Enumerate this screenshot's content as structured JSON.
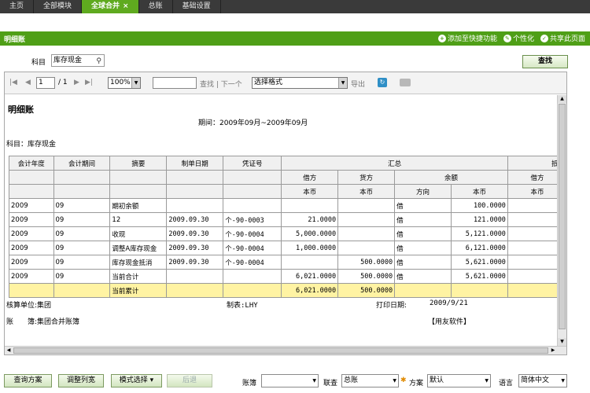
{
  "tabs": [
    {
      "label": "主页",
      "active": false
    },
    {
      "label": "全部模块",
      "active": false
    },
    {
      "label": "全球合并",
      "active": true,
      "close": "×"
    },
    {
      "label": "总账",
      "active": false
    },
    {
      "label": "基础设置",
      "active": false
    }
  ],
  "titlebar": {
    "title": "明细账",
    "add_shortcut": "添加至快捷功能",
    "personalize": "个性化",
    "share": "共享此页面"
  },
  "filter": {
    "subject_label": "科目",
    "subject_value": "库存现金",
    "search_button": "查找"
  },
  "viewer": {
    "page_current": "1",
    "page_total": "/ 1",
    "zoom": "100%",
    "find_label": "查找 | 下一个",
    "format_select": "选择格式",
    "export_label": "导出"
  },
  "report": {
    "title": "明细账",
    "period": "期间：2009年09月~2009年09月",
    "subject": "科目：库存现金",
    "header1": [
      "会计年度",
      "会计期间",
      "摘要",
      "制单日期",
      "凭证号",
      "汇总",
      "抵消"
    ],
    "header2": [
      "借方",
      "货方",
      "余额",
      "借方"
    ],
    "header3": [
      "本币",
      "本币",
      "方向",
      "本币",
      "本币"
    ],
    "rows": [
      {
        "year": "2009",
        "period": "09",
        "summary": "期初余额",
        "date": "",
        "voucher": "",
        "debit": "",
        "credit": "",
        "dir": "借",
        "balance": "100.0000",
        "offset_debit": ""
      },
      {
        "year": "2009",
        "period": "09",
        "summary": "12",
        "date": "2009.09.30",
        "voucher": "个-90-0003",
        "debit": "21.0000",
        "credit": "",
        "dir": "借",
        "balance": "121.0000",
        "offset_debit": ""
      },
      {
        "year": "2009",
        "period": "09",
        "summary": "收现",
        "date": "2009.09.30",
        "voucher": "个-90-0004",
        "debit": "5,000.0000",
        "credit": "",
        "dir": "借",
        "balance": "5,121.0000",
        "offset_debit": ""
      },
      {
        "year": "2009",
        "period": "09",
        "summary": "调整A库存现金",
        "date": "2009.09.30",
        "voucher": "个-90-0004",
        "debit": "1,000.0000",
        "credit": "",
        "dir": "借",
        "balance": "6,121.0000",
        "offset_debit": ""
      },
      {
        "year": "2009",
        "period": "09",
        "summary": "库存现金抵消",
        "date": "2009.09.30",
        "voucher": "个-90-0004",
        "debit": "",
        "credit": "500.0000",
        "dir": "借",
        "balance": "5,621.0000",
        "offset_debit": ""
      },
      {
        "year": "2009",
        "period": "09",
        "summary": "当前合计",
        "date": "",
        "voucher": "",
        "debit": "6,021.0000",
        "credit": "500.0000",
        "dir": "借",
        "balance": "5,621.0000",
        "offset_debit": ""
      },
      {
        "year": "",
        "period": "",
        "summary": "当前累计",
        "date": "",
        "voucher": "",
        "debit": "6,021.0000",
        "credit": "500.0000",
        "dir": "",
        "balance": "",
        "offset_debit": "",
        "highlight": true
      }
    ],
    "footer": {
      "unit": "核算单位:集团",
      "maker": "制表:LHY",
      "print_date_label": "打印日期:",
      "print_date": "2009/9/21",
      "book": "账　　簿:集团合并账簿",
      "software": "【用友软件】"
    }
  },
  "bottom": {
    "query_plan": "查询方案",
    "adjust_columns": "调整列宽",
    "mode_select": "模式选择",
    "back": "后退",
    "book_label": "账簿",
    "book_value": "",
    "link_label": "联查",
    "link_value": "总账",
    "plan_label": "方案",
    "plan_value": "默认",
    "lang_label": "语言",
    "lang_value": "简体中文"
  },
  "colors": {
    "green": "#4f9f17",
    "tab_active": "#5faa1f",
    "topbar": "#3a3a3a",
    "highlight": "#fff3a3"
  }
}
